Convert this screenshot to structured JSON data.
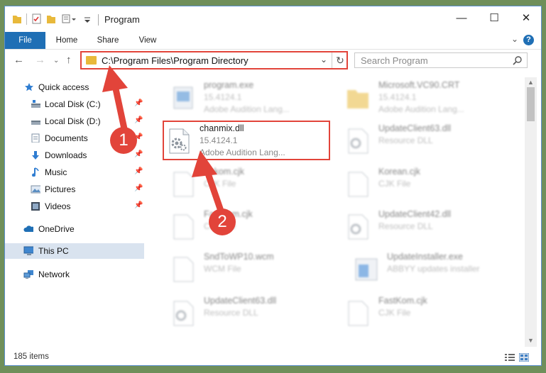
{
  "window": {
    "title": "Program",
    "controls": {
      "minimize": "—",
      "maximize": "☐",
      "close": "✕"
    }
  },
  "ribbon": {
    "tabs": [
      "File",
      "Home",
      "Share",
      "View"
    ],
    "help": "?"
  },
  "address_bar": {
    "path": "C:\\Program Files\\Program Directory"
  },
  "search": {
    "placeholder": "Search Program"
  },
  "sidebar": {
    "items": [
      {
        "label": "Quick access",
        "icon": "star-icon",
        "pinned": false
      },
      {
        "label": "Local Disk (C:)",
        "icon": "drive-icon",
        "pinned": true
      },
      {
        "label": "Local Disk (D:)",
        "icon": "drive-icon",
        "pinned": true
      },
      {
        "label": "Documents",
        "icon": "documents-icon",
        "pinned": true
      },
      {
        "label": "Downloads",
        "icon": "download-icon",
        "pinned": true
      },
      {
        "label": "Music",
        "icon": "music-icon",
        "pinned": true
      },
      {
        "label": "Pictures",
        "icon": "pictures-icon",
        "pinned": true
      },
      {
        "label": "Videos",
        "icon": "videos-icon",
        "pinned": true
      },
      {
        "label": "OneDrive",
        "icon": "cloud-icon",
        "pinned": false
      },
      {
        "label": "This PC",
        "icon": "computer-icon",
        "pinned": false,
        "selected": true
      },
      {
        "label": "Network",
        "icon": "network-icon",
        "pinned": false
      }
    ],
    "pin_glyph": "📌"
  },
  "files": [
    {
      "name": "program.exe",
      "line2": "15.4124.1",
      "line3": "Adobe Audition Lang...",
      "icon": "exe-icon"
    },
    {
      "name": "Microsoft.VC90.CRT",
      "line2": "15.4124.1",
      "line3": "Adobe Audition Lang...",
      "icon": "folder-icon"
    },
    {
      "name": "chanmix.dll",
      "line2": "15.4124.1",
      "line3": "Adobe Audition Lang...",
      "icon": "dll-gear-icon",
      "highlighted": true
    },
    {
      "name": "UpdateClient63.dll",
      "line2": "Resource DLL",
      "line3": "",
      "icon": "dll-gear-icon"
    },
    {
      "name": "Eskom.cjk",
      "line2": "CJK File",
      "line3": "",
      "icon": "file-icon"
    },
    {
      "name": "Korean.cjk",
      "line2": "CJK File",
      "line3": "",
      "icon": "file-icon"
    },
    {
      "name": "FastKom.cjk",
      "line2": "CJK File",
      "line3": "",
      "icon": "file-icon"
    },
    {
      "name": "UpdateClient42.dll",
      "line2": "Resource DLL",
      "line3": "",
      "icon": "dll-gear-icon"
    },
    {
      "name": "SndToWP10.wcm",
      "line2": "WCM File",
      "line3": "",
      "icon": "file-icon"
    },
    {
      "name": "UpdateInstaller.exe",
      "line2": "ABBYY updates installer",
      "line3": "",
      "icon": "installer-icon"
    },
    {
      "name": "UpdateClient63.dll",
      "line2": "Resource DLL",
      "line3": "",
      "icon": "dll-gear-icon"
    },
    {
      "name": "FastKom.cjk",
      "line2": "CJK File",
      "line3": "",
      "icon": "file-icon"
    }
  ],
  "status": {
    "items_count": "185 items"
  },
  "annotations": {
    "badge1": "1",
    "badge2": "2"
  },
  "colors": {
    "accent": "#1f6fb5",
    "annotation_red": "#e2443a",
    "folder_yellow": "#e8b93b"
  }
}
